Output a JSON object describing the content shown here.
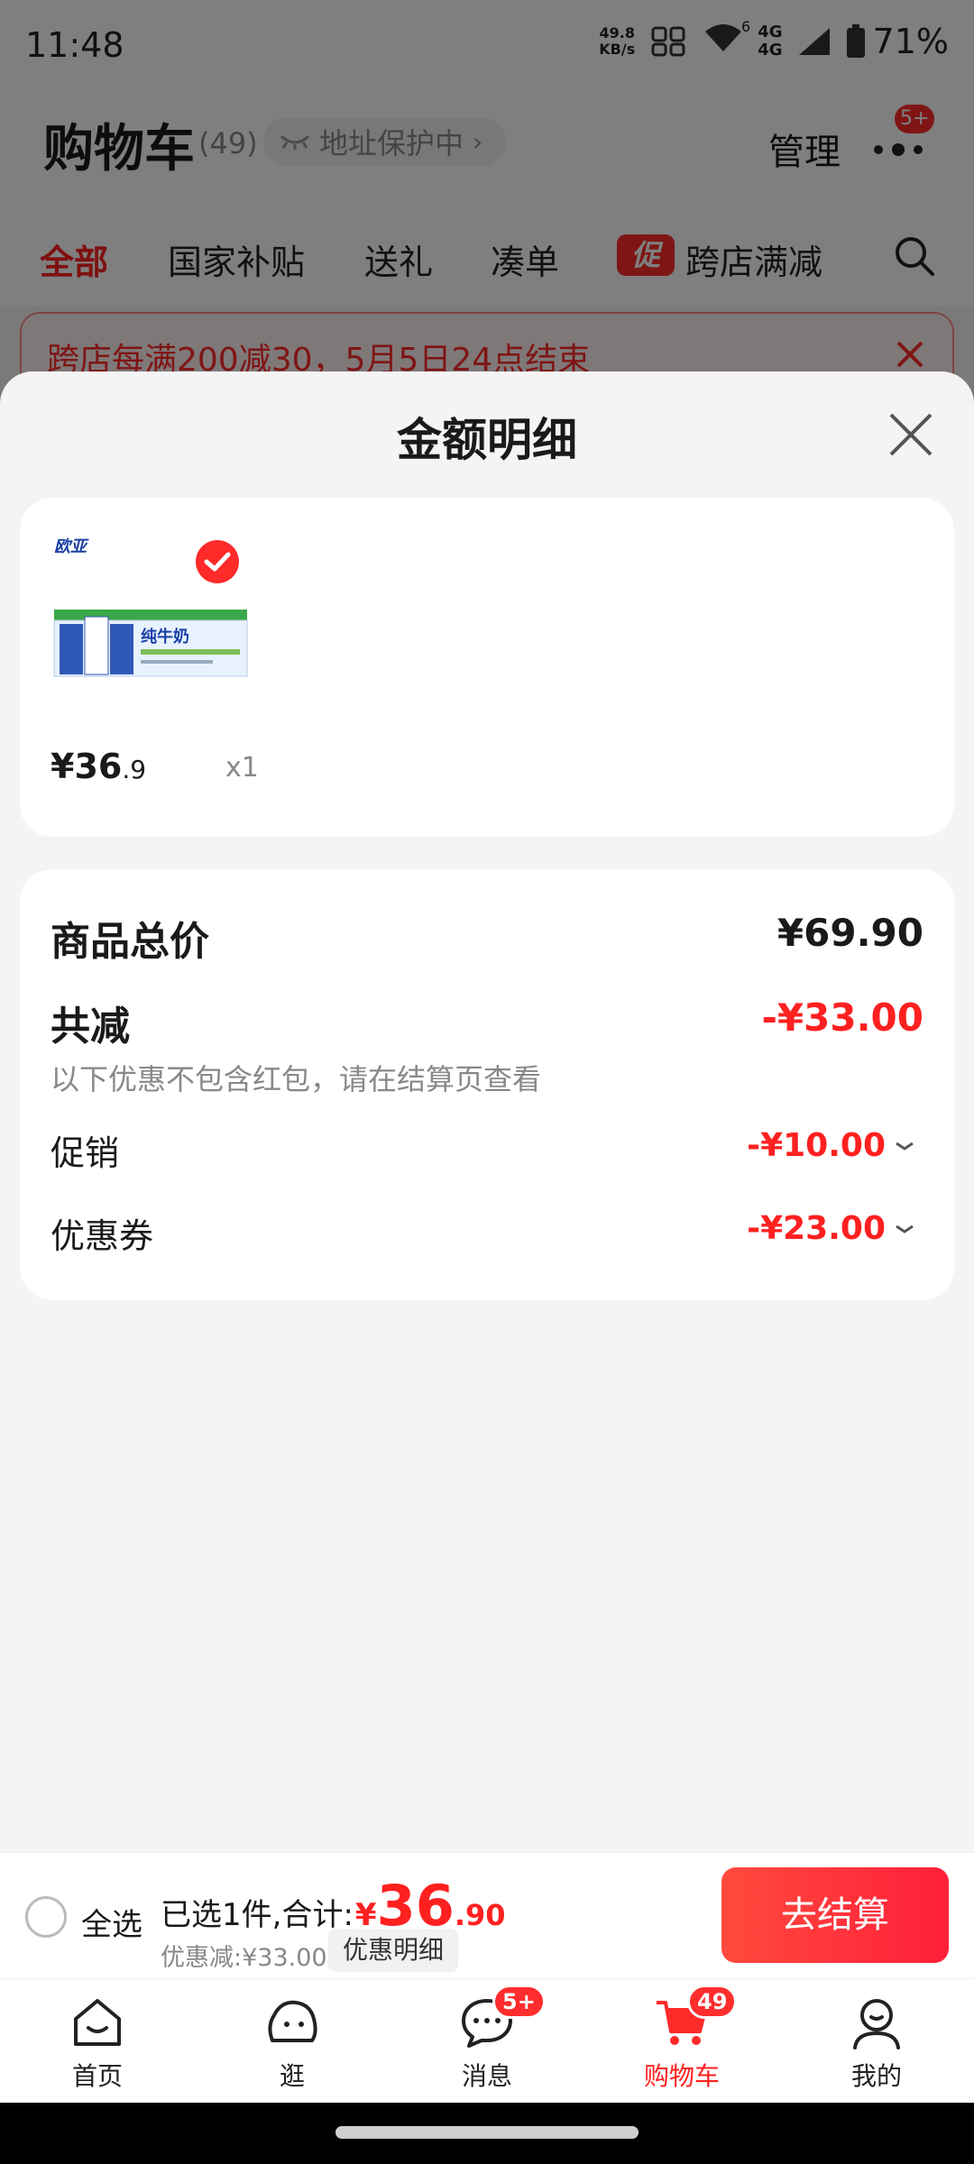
{
  "status_bar": {
    "time": "11:48",
    "net_speed_value": "49.8",
    "net_speed_unit": "KB/s",
    "wifi_gen": "6",
    "sig1": "4G",
    "sig2": "4G",
    "battery": "71%"
  },
  "header": {
    "title": "购物车",
    "count": "(49)",
    "address_label": "地址保护中",
    "address_chevron": "›",
    "manage": "管理",
    "more_badge": "5+"
  },
  "tabs": [
    {
      "label": "全部",
      "active": true
    },
    {
      "label": "国家补贴"
    },
    {
      "label": "送礼"
    },
    {
      "label": "凑单"
    },
    {
      "label": "跨店满减",
      "tag": "促"
    }
  ],
  "promo_banner": {
    "text": "跨店每满200减30，5月5日24点结束"
  },
  "sheet": {
    "title": "金额明细",
    "product": {
      "price_symbol": "¥",
      "price_int": "36",
      "price_dec": ".9",
      "qty": "x1",
      "thumb_brand": "欧亚",
      "thumb_name": "纯牛奶"
    },
    "summary": {
      "goods_total_label": "商品总价",
      "goods_total_value": "¥69.90",
      "reduction_label": "共减",
      "reduction_value": "-¥33.00",
      "note": "以下优惠不包含红包，请在结算页查看",
      "promo_label": "促销",
      "promo_value": "-¥10.00",
      "coupon_label": "优惠券",
      "coupon_value": "-¥23.00"
    }
  },
  "checkout": {
    "select_all": "全选",
    "selected_prefix": "已选1件,合计:",
    "total_symbol": "¥",
    "total_int": "36",
    "total_dec": ".90",
    "discount": "优惠减:¥33.00",
    "detail_button": "优惠明细",
    "checkout_button": "去结算"
  },
  "tabbar": [
    {
      "label": "首页",
      "icon": "home-icon"
    },
    {
      "label": "逛",
      "icon": "browse-icon"
    },
    {
      "label": "消息",
      "icon": "message-icon",
      "badge": "5+"
    },
    {
      "label": "购物车",
      "icon": "cart-icon",
      "badge": "49",
      "active": true
    },
    {
      "label": "我的",
      "icon": "profile-icon"
    }
  ],
  "colors": {
    "accent": "#ff2020",
    "overlay": "rgba(0,0,0,0.5)"
  }
}
